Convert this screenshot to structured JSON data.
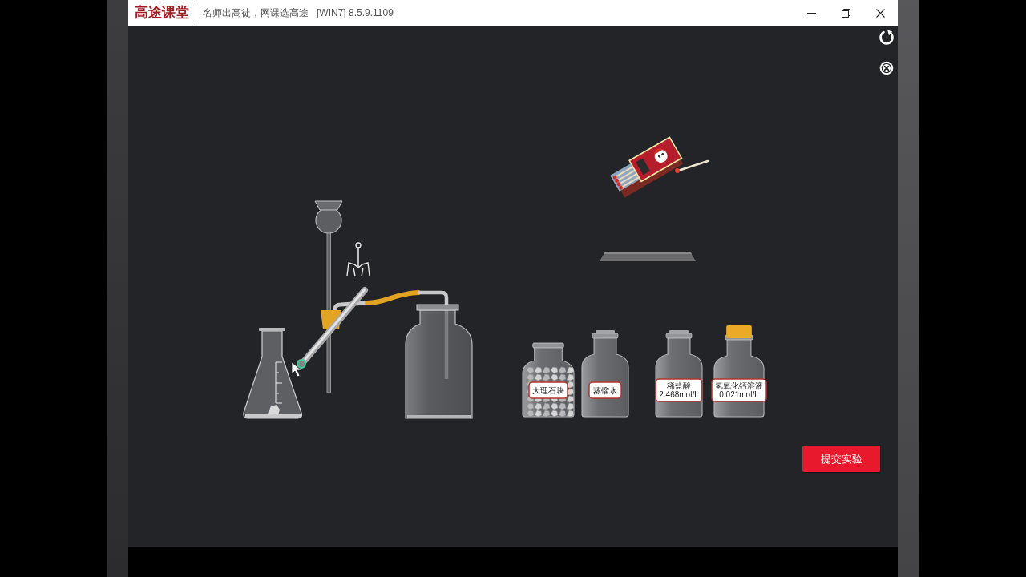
{
  "window": {
    "logo": "高途课堂",
    "slogan": "名师出高徒，网课选高途",
    "version": "[WIN7] 8.5.9.1109"
  },
  "reagents": [
    {
      "name": "大理石块",
      "kind": "solid",
      "stoppered": false
    },
    {
      "name": "蒸馏水",
      "kind": "liquid",
      "stoppered": false
    },
    {
      "name": "稀盐酸",
      "concentration": "2.468mol/L",
      "kind": "liquid",
      "stoppered": false
    },
    {
      "name": "氢氧化钙溶液",
      "concentration": "0.021mol/L",
      "kind": "liquid",
      "stoppered": true
    }
  ],
  "submit_button": {
    "label": "提交实验"
  }
}
